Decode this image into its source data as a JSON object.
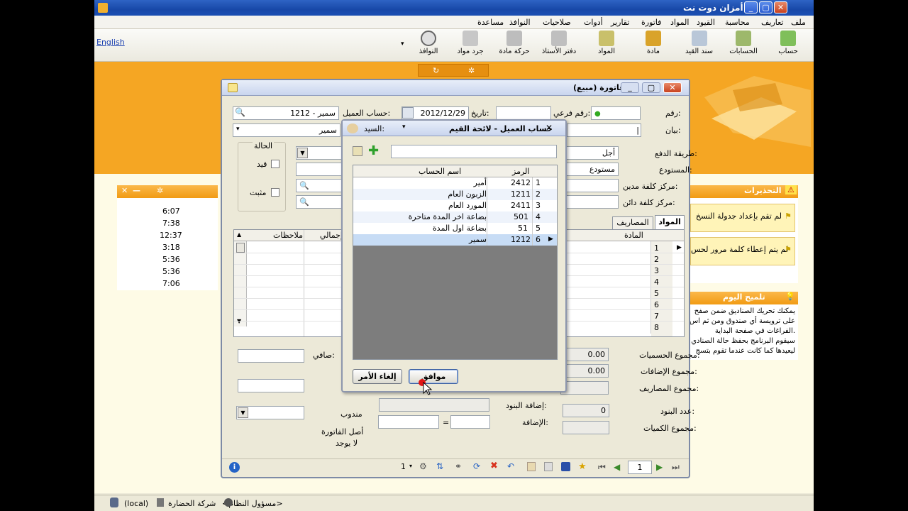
{
  "app": {
    "title": "أمزان دوت نت",
    "menu": [
      "ملف",
      "تعاريف",
      "محاسبة",
      "القيود",
      "المواد",
      "فاتورة",
      "تقارير",
      "أدوات",
      "صلاحيات",
      "النوافذ",
      "مساعدة"
    ],
    "language_link": "English",
    "toolbar": [
      "حساب",
      "الحسابات",
      "سند القيد",
      "مادة",
      "المواد",
      "دفتر الأستاذ",
      "حركة مادة",
      "جرد مواد",
      "النوافذ"
    ]
  },
  "alerts": {
    "title": "التحذيرات",
    "items": [
      "لم تقم بإعداد جدولة النسخ",
      "لم يتم إعطاء كلمة مرور لحس"
    ]
  },
  "tip": {
    "title": "تلميح اليوم",
    "lines": [
      "يمكنك تحريك الصناديق ضمن صفح",
      "على ترويسة أي صندوق ومن ثم اس",
      "الفراغات في صفحة البداية.",
      "سيقوم البرنامج بحفظ حالة الصنادي",
      "ليعيدها كما كانت عندما تقوم بتسج"
    ]
  },
  "times": [
    "6:07",
    "7:38",
    "12:37",
    "3:18",
    "5:36",
    "5:36",
    "7:06"
  ],
  "invoice": {
    "title": "فاتورة (مبيع)",
    "labels": {
      "number": "رقم:",
      "sub_number": "رقم فرعي:",
      "date": "تاريخ:",
      "customer_account": "حساب العميل:",
      "statement": "بيان:",
      "payment_method": "طريقة الدفع:",
      "warehouse": "المستودع:",
      "debit_cost_center": "مركز كلفة مدين:",
      "credit_cost_center": "مركز كلفة دائن:",
      "status": "الحالة",
      "posted": "قيد",
      "fixed": "مثبت",
      "net": "صافي:",
      "total_discounts": "مجموع الحسميات:",
      "total_additions": "مجموع الإضافات:",
      "total_expenses": "مجموع المصاريف:",
      "items_count": "عدد البنود:",
      "total_quantities": "مجموع الكميات:",
      "add_items": "إضافة البنود:",
      "addition": "الإضافة:",
      "delegate": "مندوب",
      "invoice_original": "أصل الفاتورة",
      "none": "لا يوجد",
      "material_col": "المادة",
      "notes_col": "ملاحظات",
      "total_col": "إجمالي"
    },
    "values": {
      "date": "2012/12/29",
      "customer": "1212 - سمير",
      "statement_customer": "سمير",
      "payment_method": "أجل",
      "warehouse": "مستودع",
      "total_discounts": "0.00",
      "total_additions": "0.00",
      "items_count": "0",
      "equals": "=",
      "page": "1",
      "page_total": "1"
    },
    "tabs": [
      "المواد",
      "المصاريف"
    ],
    "row_numbers": [
      "1",
      "2",
      "3",
      "4",
      "5",
      "6",
      "7",
      "8"
    ]
  },
  "dialog": {
    "title": "حساب العميل - لائحة القيم",
    "mister_label": "السيد:",
    "columns": {
      "code": "الرمز",
      "name": "اسم الحساب"
    },
    "rows": [
      {
        "n": "1",
        "code": "2412",
        "name": "أمير"
      },
      {
        "n": "2",
        "code": "1211",
        "name": "الزبون العام"
      },
      {
        "n": "3",
        "code": "2411",
        "name": "المورد العام"
      },
      {
        "n": "4",
        "code": "501",
        "name": "بضاعة اخر المدة متاحرة"
      },
      {
        "n": "5",
        "code": "51",
        "name": "بضاعة اول المدة"
      },
      {
        "n": "6",
        "code": "1212",
        "name": "سمير"
      }
    ],
    "ok": "موافق",
    "cancel": "إلغاء الأمر"
  },
  "status": {
    "server": "(local)",
    "company": "شركة الحضارة",
    "user": "<مسؤول النظام>"
  },
  "colors": {
    "orange": "#f5a623",
    "selection": "#c7dcf5",
    "title_blue": "#1b4fb3"
  }
}
